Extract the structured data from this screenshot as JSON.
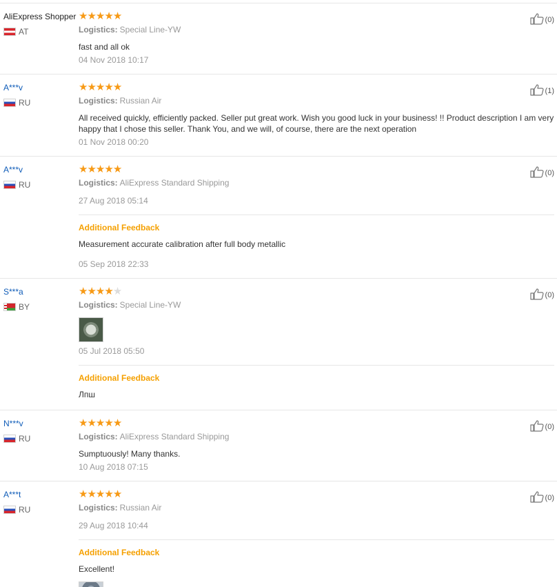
{
  "reviews": [
    {
      "user": "AliExpress Shopper",
      "country": "AT",
      "flag": "flag-at",
      "masked": false,
      "stars": 5,
      "logistics_label": "Logistics:",
      "logistics": "Special Line-YW",
      "text": "fast and all ok",
      "date": "04 Nov 2018 10:17",
      "likes": "(0)",
      "padBottom": 0
    },
    {
      "user": "A***v",
      "country": "RU",
      "flag": "flag-ru",
      "masked": true,
      "stars": 5,
      "logistics_label": "Logistics:",
      "logistics": "Russian Air",
      "text": "All received quickly, efficiently packed. Seller put great work. Wish you good luck in your business! !! Product description I am very happy that I chose this seller. Thank You, and we will, of course, there are the next operation",
      "date": "01 Nov 2018 00:20",
      "likes": "(1)"
    },
    {
      "user": "A***v",
      "country": "RU",
      "flag": "flag-ru",
      "masked": true,
      "stars": 5,
      "logistics_label": "Logistics:",
      "logistics": "AliExpress Standard Shipping",
      "text": "",
      "date": "27 Aug 2018 05:14",
      "likes": "(0)",
      "additional": {
        "title": "Additional Feedback",
        "text": "Measurement accurate calibration after full body metallic",
        "date": "05 Sep 2018 22:33"
      }
    },
    {
      "user": "S***a",
      "country": "BY",
      "flag": "flag-by",
      "masked": true,
      "stars": 4,
      "logistics_label": "Logistics:",
      "logistics": "Special Line-YW",
      "text": "",
      "photo": true,
      "date": "05 Jul 2018 05:50",
      "likes": "(0)",
      "additional": {
        "title": "Additional Feedback",
        "text": "Лпш",
        "date": ""
      }
    },
    {
      "user": "N***v",
      "country": "RU",
      "flag": "flag-ru",
      "masked": true,
      "stars": 5,
      "logistics_label": "Logistics:",
      "logistics": "AliExpress Standard Shipping",
      "text": "Sumptuously! Many thanks.",
      "date": "10 Aug 2018 07:15",
      "likes": "(0)"
    },
    {
      "user": "A***t",
      "country": "RU",
      "flag": "flag-ru",
      "masked": true,
      "stars": 5,
      "logistics_label": "Logistics:",
      "logistics": "Russian Air",
      "text": "",
      "date": "29 Aug 2018 10:44",
      "likes": "(0)",
      "additional": {
        "title": "Additional Feedback",
        "text": "Excellent!",
        "date": "",
        "photo": true
      }
    }
  ],
  "icons": {
    "star": "star-icon",
    "like": "thumbs-up-icon",
    "flag": "country-flag-icon"
  },
  "colors": {
    "star": "#f79a16",
    "username": "#0f5cb8",
    "additional": "#f5a000",
    "muted": "#999999"
  }
}
